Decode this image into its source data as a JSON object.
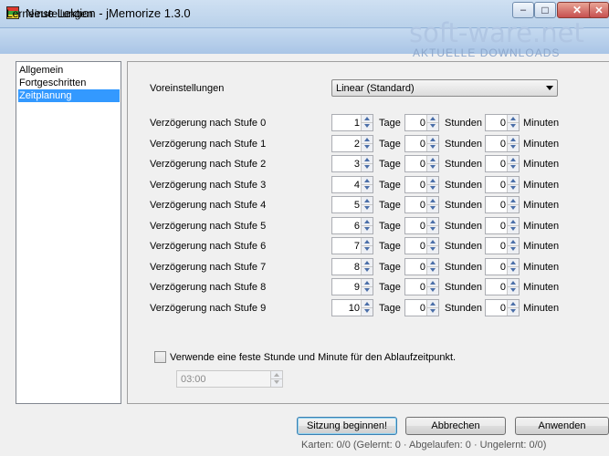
{
  "window": {
    "title": "Neue Lektion - jMemorize 1.3.0",
    "min_glyph": "–",
    "max_glyph": "□",
    "close_glyph": "✕"
  },
  "dialog": {
    "title": "Lerneinstellungen",
    "close_glyph": "✕"
  },
  "watermark": {
    "main": "soft-ware.net",
    "sub": "AKTUELLE DOWNLOADS"
  },
  "nav": {
    "items": [
      "Allgemein",
      "Fortgeschritten",
      "Zeitplanung"
    ],
    "selected": "Zeitplanung"
  },
  "preset": {
    "label": "Voreinstellungen",
    "value": "Linear (Standard)"
  },
  "units": {
    "days": "Tage",
    "hours": "Stunden",
    "minutes": "Minuten"
  },
  "stages": [
    {
      "label": "Verzögerung nach Stufe 0",
      "days": "1",
      "hours": "0",
      "minutes": "0"
    },
    {
      "label": "Verzögerung nach Stufe 1",
      "days": "2",
      "hours": "0",
      "minutes": "0"
    },
    {
      "label": "Verzögerung nach Stufe 2",
      "days": "3",
      "hours": "0",
      "minutes": "0"
    },
    {
      "label": "Verzögerung nach Stufe 3",
      "days": "4",
      "hours": "0",
      "minutes": "0"
    },
    {
      "label": "Verzögerung nach Stufe 4",
      "days": "5",
      "hours": "0",
      "minutes": "0"
    },
    {
      "label": "Verzögerung nach Stufe 5",
      "days": "6",
      "hours": "0",
      "minutes": "0"
    },
    {
      "label": "Verzögerung nach Stufe 6",
      "days": "7",
      "hours": "0",
      "minutes": "0"
    },
    {
      "label": "Verzögerung nach Stufe 7",
      "days": "8",
      "hours": "0",
      "minutes": "0"
    },
    {
      "label": "Verzögerung nach Stufe 8",
      "days": "9",
      "hours": "0",
      "minutes": "0"
    },
    {
      "label": "Verzögerung nach Stufe 9",
      "days": "10",
      "hours": "0",
      "minutes": "0"
    }
  ],
  "fixed_time": {
    "label": "Verwende eine feste Stunde und Minute für den Ablaufzeitpunkt.",
    "checked": false,
    "value": "03:00"
  },
  "buttons": {
    "start": "Sitzung beginnen!",
    "cancel": "Abbrechen",
    "apply": "Anwenden"
  },
  "statusbar": {
    "text": "Karten: 0/0 (Gelernt: 0 · Abgelaufen: 0 · Ungelernt: 0/0)"
  },
  "colors": {
    "selection": "#3399ff",
    "titlebar": "#b9d1ea"
  }
}
